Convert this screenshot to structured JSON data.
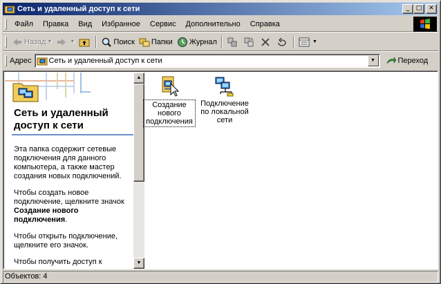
{
  "window": {
    "title": "Сеть и удаленный доступ к сети",
    "minimize": "_",
    "maximize": "□",
    "close": "✕"
  },
  "menu": {
    "items": [
      "Файл",
      "Правка",
      "Вид",
      "Избранное",
      "Сервис",
      "Дополнительно",
      "Справка"
    ]
  },
  "toolbar": {
    "back_label": "Назад",
    "search_label": "Поиск",
    "folders_label": "Папки",
    "history_label": "Журнал"
  },
  "address": {
    "label": "Адрес",
    "value": "Сеть и удаленный доступ к сети",
    "go_label": "Переход"
  },
  "left_pane": {
    "title": "Сеть и удаленный доступ к сети",
    "para1": "Эта папка содержит сетевые подключения для данного компьютера, а также мастер создания новых подключений.",
    "para2_prefix": "Чтобы создать новое подключение, щелкните значок ",
    "para2_bold": "Создание нового подключения",
    "para2_suffix": ".",
    "para3": "Чтобы открыть подключение, щелкните его значок.",
    "para4": "Чтобы получить доступ к"
  },
  "icons": [
    {
      "label": "Создание нового подключения",
      "selected": true
    },
    {
      "label": "Подключение по локальной сети",
      "selected": false
    }
  ],
  "status": {
    "text": "Объектов: 4"
  },
  "colors": {
    "titlebar_start": "#0a246a",
    "titlebar_end": "#a6caf0",
    "face": "#d4d0c8",
    "pane_rule": "#6b8fc7"
  }
}
